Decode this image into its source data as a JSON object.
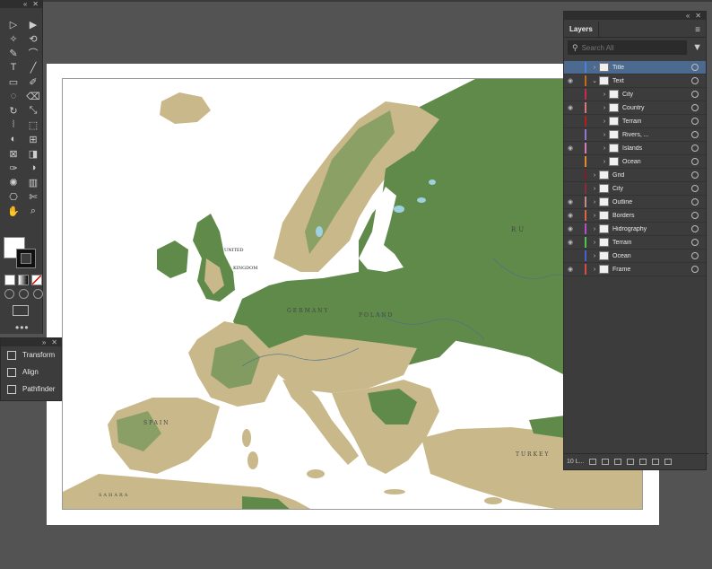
{
  "tools_panel": {
    "tools": [
      "selection",
      "direct-selection",
      "magic-wand",
      "lasso",
      "pen",
      "curvature",
      "type",
      "line",
      "rectangle",
      "paintbrush",
      "shaper",
      "eraser",
      "rotate",
      "scale",
      "width",
      "free-transform",
      "shape-builder",
      "perspective-grid",
      "mesh",
      "gradient",
      "eyedropper",
      "blend",
      "symbol-sprayer",
      "column-graph",
      "artboard",
      "slice",
      "hand",
      "zoom"
    ],
    "more": "•••"
  },
  "mini_panel": {
    "items": [
      {
        "label": "Transform",
        "icon": "transform-icon"
      },
      {
        "label": "Align",
        "icon": "align-icon"
      },
      {
        "label": "Pathfinder",
        "icon": "pathfinder-icon"
      }
    ]
  },
  "layers_panel": {
    "tab": "Layers",
    "search_placeholder": "Search All",
    "footer_count": "10 L...",
    "layers": [
      {
        "name": "Title",
        "visible": false,
        "color": "#4f7fd6",
        "indent": 0,
        "selected": true
      },
      {
        "name": "Text",
        "visible": true,
        "color": "#c36b1c",
        "indent": 0,
        "expanded": true
      },
      {
        "name": "City",
        "visible": false,
        "color": "#cc2a4a",
        "indent": 1
      },
      {
        "name": "Country",
        "visible": true,
        "color": "#d47a7a",
        "indent": 1
      },
      {
        "name": "Terrain",
        "visible": false,
        "color": "#b12020",
        "indent": 1
      },
      {
        "name": "Rivers, ...",
        "visible": false,
        "color": "#8c7ad1",
        "indent": 1
      },
      {
        "name": "Islands",
        "visible": true,
        "color": "#d67ab8",
        "indent": 1
      },
      {
        "name": "Ocean",
        "visible": false,
        "color": "#e38a2c",
        "indent": 1
      },
      {
        "name": "Grid",
        "visible": false,
        "color": "#7a1f2a",
        "indent": 0
      },
      {
        "name": "City",
        "visible": false,
        "color": "#8a2a3a",
        "indent": 0
      },
      {
        "name": "Outline",
        "visible": true,
        "color": "#c78a8a",
        "indent": 0
      },
      {
        "name": "Borders",
        "visible": true,
        "color": "#e0643c",
        "indent": 0
      },
      {
        "name": "Hidrography",
        "visible": true,
        "color": "#b44fc8",
        "indent": 0
      },
      {
        "name": "Terrain",
        "visible": true,
        "color": "#4cc84c",
        "indent": 0
      },
      {
        "name": "Ocean",
        "visible": false,
        "color": "#4a5fcf",
        "indent": 0
      },
      {
        "name": "Frame",
        "visible": true,
        "color": "#d94a4a",
        "indent": 0
      }
    ]
  },
  "map_labels": {
    "uk": "UNITED",
    "uk2": "KINGDOM",
    "germany": "GERMANY",
    "poland": "POLAND",
    "spain": "SPAIN",
    "turkey": "TURKEY",
    "sahara": "SAHARA",
    "ru": "RU"
  },
  "colors": {
    "land_green": "#5f8a4a",
    "land_tan": "#c9b98a",
    "water": "#ffffff",
    "lake": "#9fd0e0",
    "selection": "#4c6a8f"
  }
}
